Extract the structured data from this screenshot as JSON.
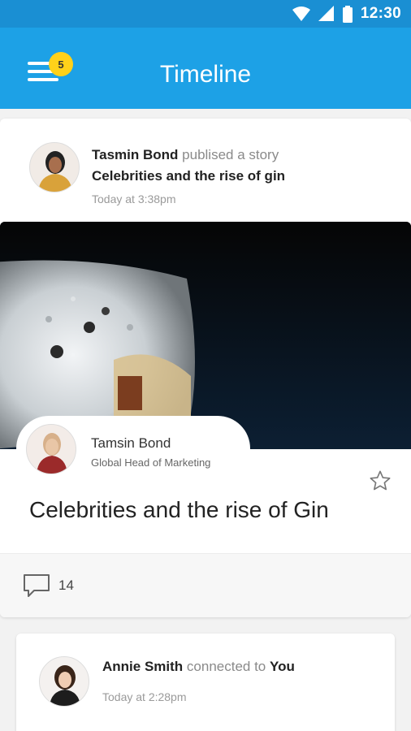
{
  "status_bar": {
    "time": "12:30",
    "icons": [
      "wifi-icon",
      "cellular-signal-icon",
      "battery-icon"
    ]
  },
  "app_bar": {
    "title": "Timeline",
    "menu_icon": "hamburger-menu-icon",
    "notification_count": "5",
    "colors": {
      "bar": "#1da1e6",
      "badge": "#ffd11a"
    }
  },
  "story_card": {
    "author_name": "Tasmin Bond",
    "action": "publised a story",
    "story_title": "Celebrities and the rise of gin",
    "timestamp": "Today at 3:38pm",
    "hero_image": "gin-glass-photo",
    "byline_name": "Tamsin Bond",
    "byline_role": "Global Head of Marketing",
    "headline": "Celebrities and the rise of Gin",
    "star_icon": "star-outline-icon",
    "comment_icon": "comment-icon",
    "comment_count": "14"
  },
  "connection_card": {
    "name": "Annie Smith",
    "action": "connected to",
    "target": "You",
    "timestamp": "Today at 2:28pm"
  }
}
